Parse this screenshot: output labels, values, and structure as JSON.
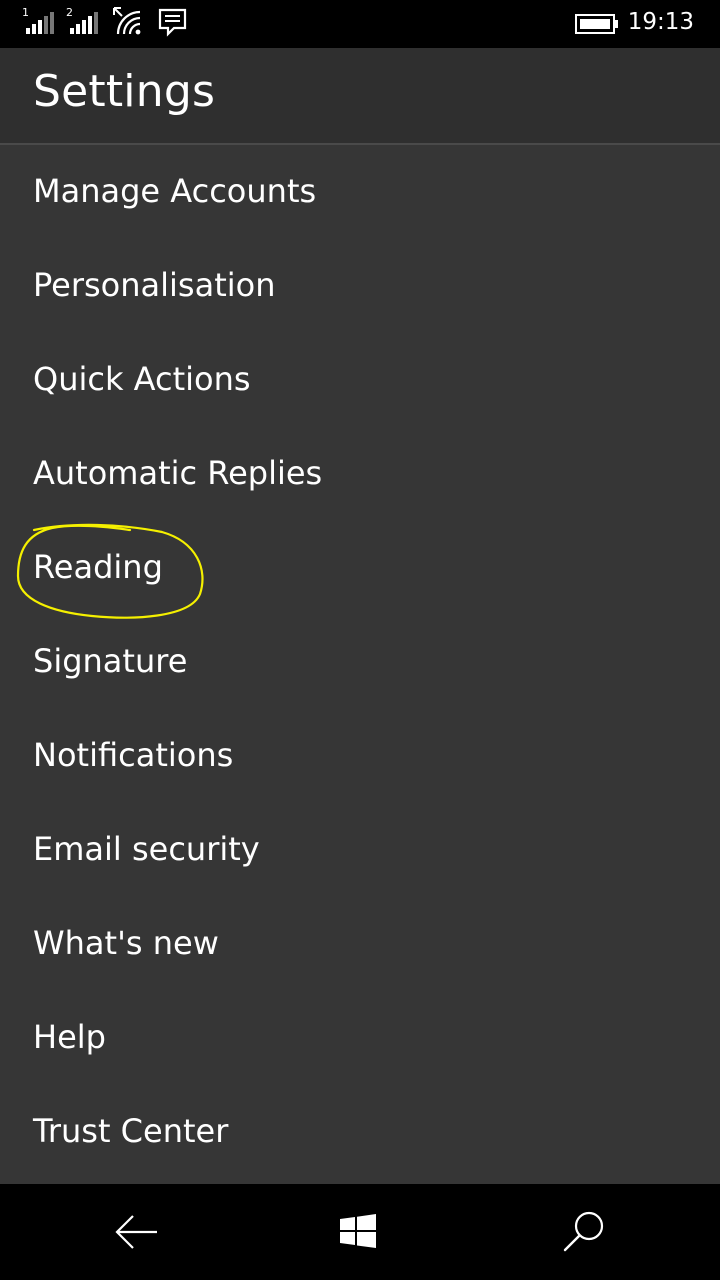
{
  "status_bar": {
    "time": "19:13",
    "sim1_label": "1",
    "sim2_label": "2",
    "icons": [
      "signal-sim1-icon",
      "signal-sim2-icon",
      "wifi-icon",
      "message-icon",
      "battery-icon"
    ]
  },
  "header": {
    "title": "Settings"
  },
  "settings": {
    "items": [
      {
        "label": "Manage Accounts"
      },
      {
        "label": "Personalisation"
      },
      {
        "label": "Quick Actions"
      },
      {
        "label": "Automatic Replies"
      },
      {
        "label": "Reading"
      },
      {
        "label": "Signature"
      },
      {
        "label": "Notifications"
      },
      {
        "label": "Email security"
      },
      {
        "label": "What's new"
      },
      {
        "label": "Help"
      },
      {
        "label": "Trust Center"
      }
    ]
  },
  "annotation": {
    "highlighted_item": "Reading",
    "color": "#f5f000"
  },
  "nav_bar": {
    "icons": [
      "back-arrow-icon",
      "windows-start-icon",
      "search-icon"
    ]
  },
  "colors": {
    "background": "#363636",
    "header": "#2f2f2f",
    "bars": "#000000",
    "text": "#ffffff"
  }
}
